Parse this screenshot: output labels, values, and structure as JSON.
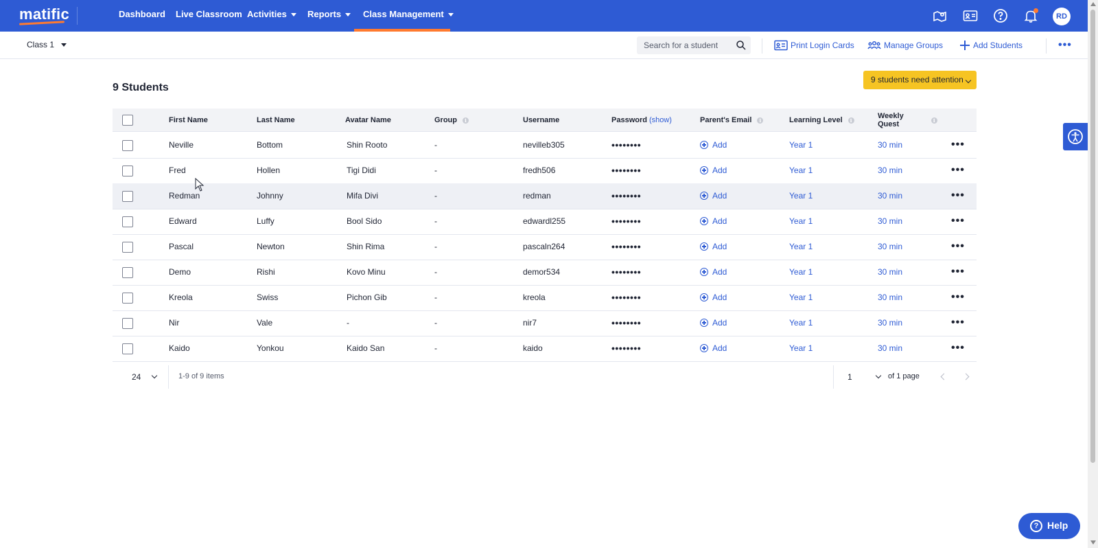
{
  "app": {
    "logo_text": "matific"
  },
  "nav": {
    "items": [
      {
        "label": "Dashboard",
        "has_caret": false
      },
      {
        "label": "Live Classroom",
        "has_caret": false
      },
      {
        "label": "Activities",
        "has_caret": true
      },
      {
        "label": "Reports",
        "has_caret": true
      },
      {
        "label": "Class Management",
        "has_caret": true,
        "active": true
      }
    ],
    "icons": [
      "map-icon",
      "id-card-icon",
      "help-circle-icon",
      "bell-icon"
    ],
    "user_initials": "RD",
    "brand_color": "#2e5bd4",
    "accent_color": "#ff7a2f"
  },
  "toolbar": {
    "class_label": "Class 1",
    "search_placeholder": "Search for a student",
    "search_value": "",
    "print_login_cards": "Print Login Cards",
    "manage_groups": "Manage Groups",
    "add_students": "Add Students",
    "more": "•••"
  },
  "page": {
    "title": "9 Students",
    "attention_label": "9 students need attention",
    "attention_color": "#f6c423"
  },
  "table": {
    "headers": {
      "first_name": "First Name",
      "last_name": "Last Name",
      "avatar_name": "Avatar Name",
      "group": "Group",
      "username": "Username",
      "password": "Password",
      "password_show": "(show)",
      "parent_email": "Parent's Email",
      "learning_level": "Learning Level",
      "weekly_quest_1": "Weekly",
      "weekly_quest_2": "Quest"
    },
    "info_glyph": "i",
    "password_mask": "••••••••",
    "add_label": "Add",
    "row_menu": "•••",
    "rows": [
      {
        "first": "Neville",
        "last": "Bottom",
        "avatar": "Shin Rooto",
        "group": "-",
        "username": "nevilleb305",
        "level": "Year 1",
        "quest": "30 min"
      },
      {
        "first": "Fred",
        "last": "Hollen",
        "avatar": "Tigi Didi",
        "group": "-",
        "username": "fredh506",
        "level": "Year 1",
        "quest": "30 min"
      },
      {
        "first": "Redman",
        "last": "Johnny",
        "avatar": "Mifa Divi",
        "group": "-",
        "username": "redman",
        "level": "Year 1",
        "quest": "30 min"
      },
      {
        "first": "Edward",
        "last": "Luffy",
        "avatar": "Bool Sido",
        "group": "-",
        "username": "edwardl255",
        "level": "Year 1",
        "quest": "30 min"
      },
      {
        "first": "Pascal",
        "last": "Newton",
        "avatar": "Shin Rima",
        "group": "-",
        "username": "pascaln264",
        "level": "Year 1",
        "quest": "30 min"
      },
      {
        "first": "Demo",
        "last": "Rishi",
        "avatar": "Kovo Minu",
        "group": "-",
        "username": "demor534",
        "level": "Year 1",
        "quest": "30 min"
      },
      {
        "first": "Kreola",
        "last": "Swiss",
        "avatar": "Pichon Gib",
        "group": "-",
        "username": "kreola",
        "level": "Year 1",
        "quest": "30 min"
      },
      {
        "first": "Nir",
        "last": "Vale",
        "avatar": "-",
        "group": "-",
        "username": "nir7",
        "level": "Year 1",
        "quest": "30 min"
      },
      {
        "first": "Kaido",
        "last": "Yonkou",
        "avatar": "Kaido San",
        "group": "-",
        "username": "kaido",
        "level": "Year 1",
        "quest": "30 min"
      }
    ]
  },
  "pagination": {
    "per_page": "24",
    "items_label": "1-9 of 9 items",
    "current_page": "1",
    "of_pages": "of 1 page"
  },
  "help": {
    "label": "Help",
    "glyph": "?"
  }
}
